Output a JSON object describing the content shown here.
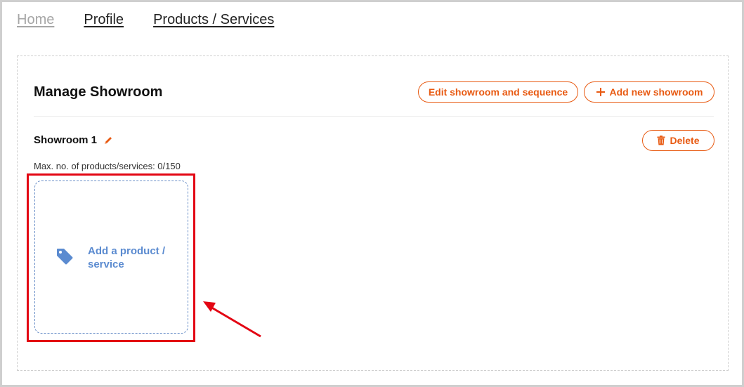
{
  "nav": {
    "home": "Home",
    "profile": "Profile",
    "products": "Products / Services"
  },
  "panel": {
    "title": "Manage Showroom",
    "edit_button": "Edit showroom and sequence",
    "add_button": "Add new showroom"
  },
  "showroom": {
    "name": "Showroom 1",
    "delete_button": "Delete",
    "max_products": "Max. no. of products/services: 0/150",
    "add_card_label": "Add a product / service"
  },
  "icons": {
    "plus": "plus-icon",
    "pencil": "pencil-icon",
    "trash": "trash-icon",
    "tag": "tag-icon",
    "arrow": "annotation-arrow"
  },
  "colors": {
    "accent": "#e85a12",
    "link_blue": "#5b8bd0",
    "highlight_red": "#e30613"
  }
}
